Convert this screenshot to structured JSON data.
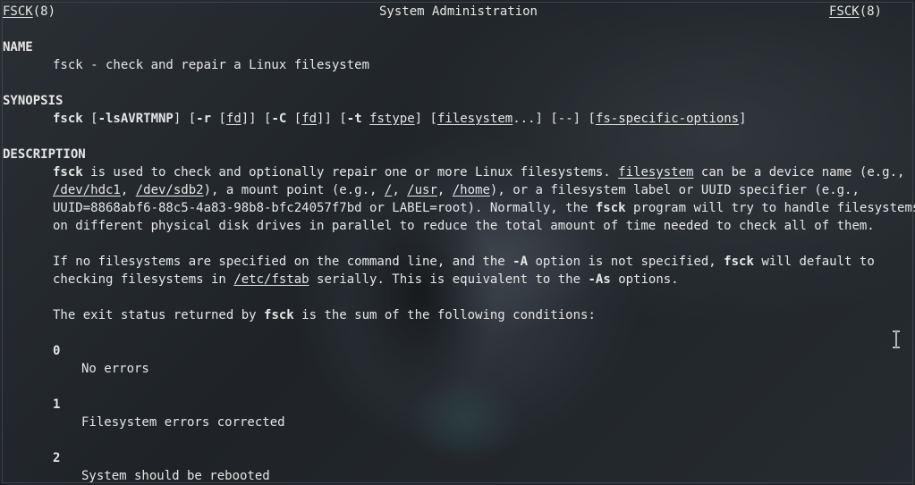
{
  "header": {
    "left_name": "FSCK",
    "left_section": "(8)",
    "center": "System Administration",
    "right_name": "FSCK",
    "right_section": "(8)"
  },
  "name_section": {
    "heading": "NAME",
    "text": "fsck - check and repair a Linux filesystem"
  },
  "synopsis": {
    "heading": "SYNOPSIS",
    "cmd": "fsck",
    "p1": " [",
    "opt_lsav": "-lsAVRTMNP",
    "p2": "] [",
    "opt_r": "-r",
    "p3": " [",
    "fd1": "fd",
    "p4": "]] [",
    "opt_c": "-C",
    "p5": " [",
    "fd2": "fd",
    "p6": "]] [",
    "opt_t": "-t",
    "p7": " ",
    "fstype": "fstype",
    "p8": "] [",
    "filesystem": "filesystem",
    "p9": "...] [--] [",
    "fs_specific": "fs-specific-options",
    "p10": "]"
  },
  "description": {
    "heading": "DESCRIPTION",
    "l1_fsck": "fsck",
    "l1_a": " is used to check and optionally repair one or more Linux filesystems. ",
    "l1_filesystem": "filesystem",
    "l1_b": " can be a device name (e.g.,",
    "l2_hdc1": "/dev/hdc1",
    "l2_a": ", ",
    "l2_sdb2": "/dev/sdb2",
    "l2_b": "), a mount point (e.g., ",
    "l2_root": "/",
    "l2_c": ", ",
    "l2_usr": "/usr",
    "l2_d": ", ",
    "l2_home": "/home",
    "l2_e": "), or a filesystem label or UUID specifier (e.g.,",
    "l3_a": "UUID=8868abf6-88c5-4a83-98b8-bfc24057f7bd or LABEL=root). Normally, the ",
    "l3_fsck": "fsck",
    "l3_b": " program will try to handle filesystems",
    "l4": "on different physical disk drives in parallel to reduce the total amount of time needed to check all of them.",
    "p2_l1_a": "If no filesystems are specified on the command line, and the ",
    "p2_l1_A": "-A",
    "p2_l1_b": " option is not specified, ",
    "p2_l1_fsck": "fsck",
    "p2_l1_c": " will default to",
    "p2_l2_a": "checking filesystems in ",
    "p2_l2_fstab": "/etc/fstab",
    "p2_l2_b": " serially. This is equivalent to the ",
    "p2_l2_As": "-As",
    "p2_l2_c": " options.",
    "p3_a": "The exit status returned by ",
    "p3_fsck": "fsck",
    "p3_b": " is the sum of the following conditions:"
  },
  "exit_codes": [
    {
      "code": "0",
      "desc": "No errors"
    },
    {
      "code": "1",
      "desc": "Filesystem errors corrected"
    },
    {
      "code": "2",
      "desc": "System should be rebooted"
    }
  ]
}
